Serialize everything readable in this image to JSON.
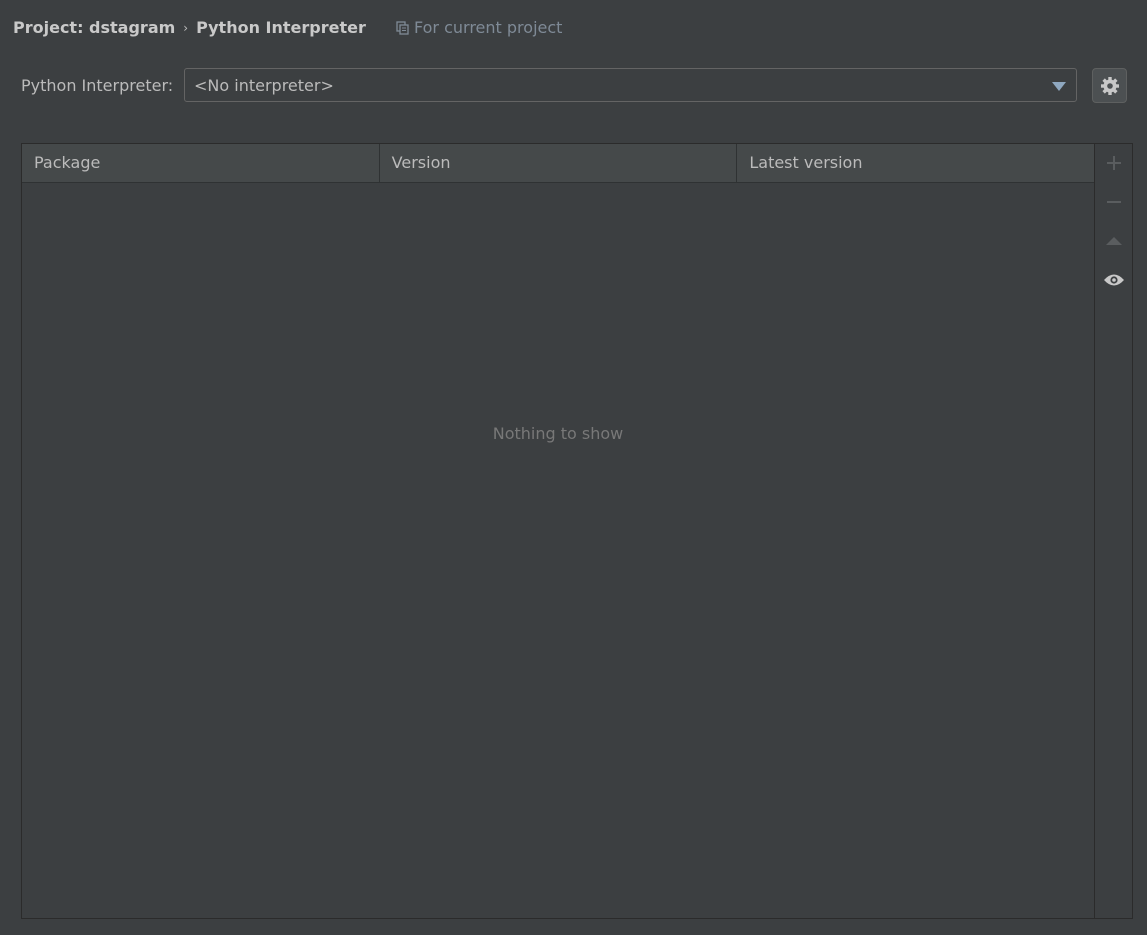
{
  "breadcrumb": {
    "project": "Project: dstagram",
    "separator": "›",
    "page": "Python Interpreter"
  },
  "scope": {
    "label": "For current project",
    "icon": "copy-icon"
  },
  "interpreter": {
    "label": "Python Interpreter:",
    "value": "<No interpreter>"
  },
  "table": {
    "columns": [
      "Package",
      "Version",
      "Latest version"
    ],
    "empty_text": "Nothing to show"
  },
  "toolbar": {
    "icons": [
      "plus-icon",
      "minus-icon",
      "upgrade-icon",
      "eye-icon"
    ]
  },
  "colors": {
    "background": "#3c3f41",
    "header": "#45494a",
    "accent": "#7f9fbf"
  }
}
